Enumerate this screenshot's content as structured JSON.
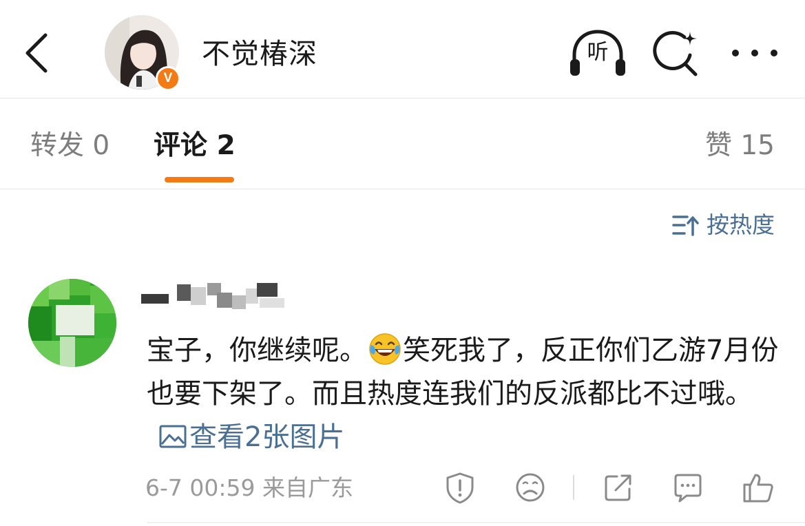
{
  "header": {
    "title": "不觉椿深",
    "verified_badge": "V",
    "listen_label": "听",
    "icons": [
      "back-icon",
      "headphones-icon",
      "search-sparkle-icon",
      "more-icon"
    ]
  },
  "tabs": {
    "repost": "转发 0",
    "comment": "评论 2",
    "like": "赞 15",
    "active": "comment"
  },
  "sort": {
    "label": "按热度"
  },
  "comment": {
    "text_before_emoji": "宝子，你继续呢。",
    "text_after_emoji": "笑死我了，反正你们乙游7月份也要下架了。而且热度连我们的反派都比不过哦。",
    "view_images": "查看2张图片",
    "meta": "6-7 00:59 来自广东"
  },
  "colors": {
    "accent": "#f47a14",
    "link": "#4a6f95",
    "muted": "#9a9a9a"
  }
}
